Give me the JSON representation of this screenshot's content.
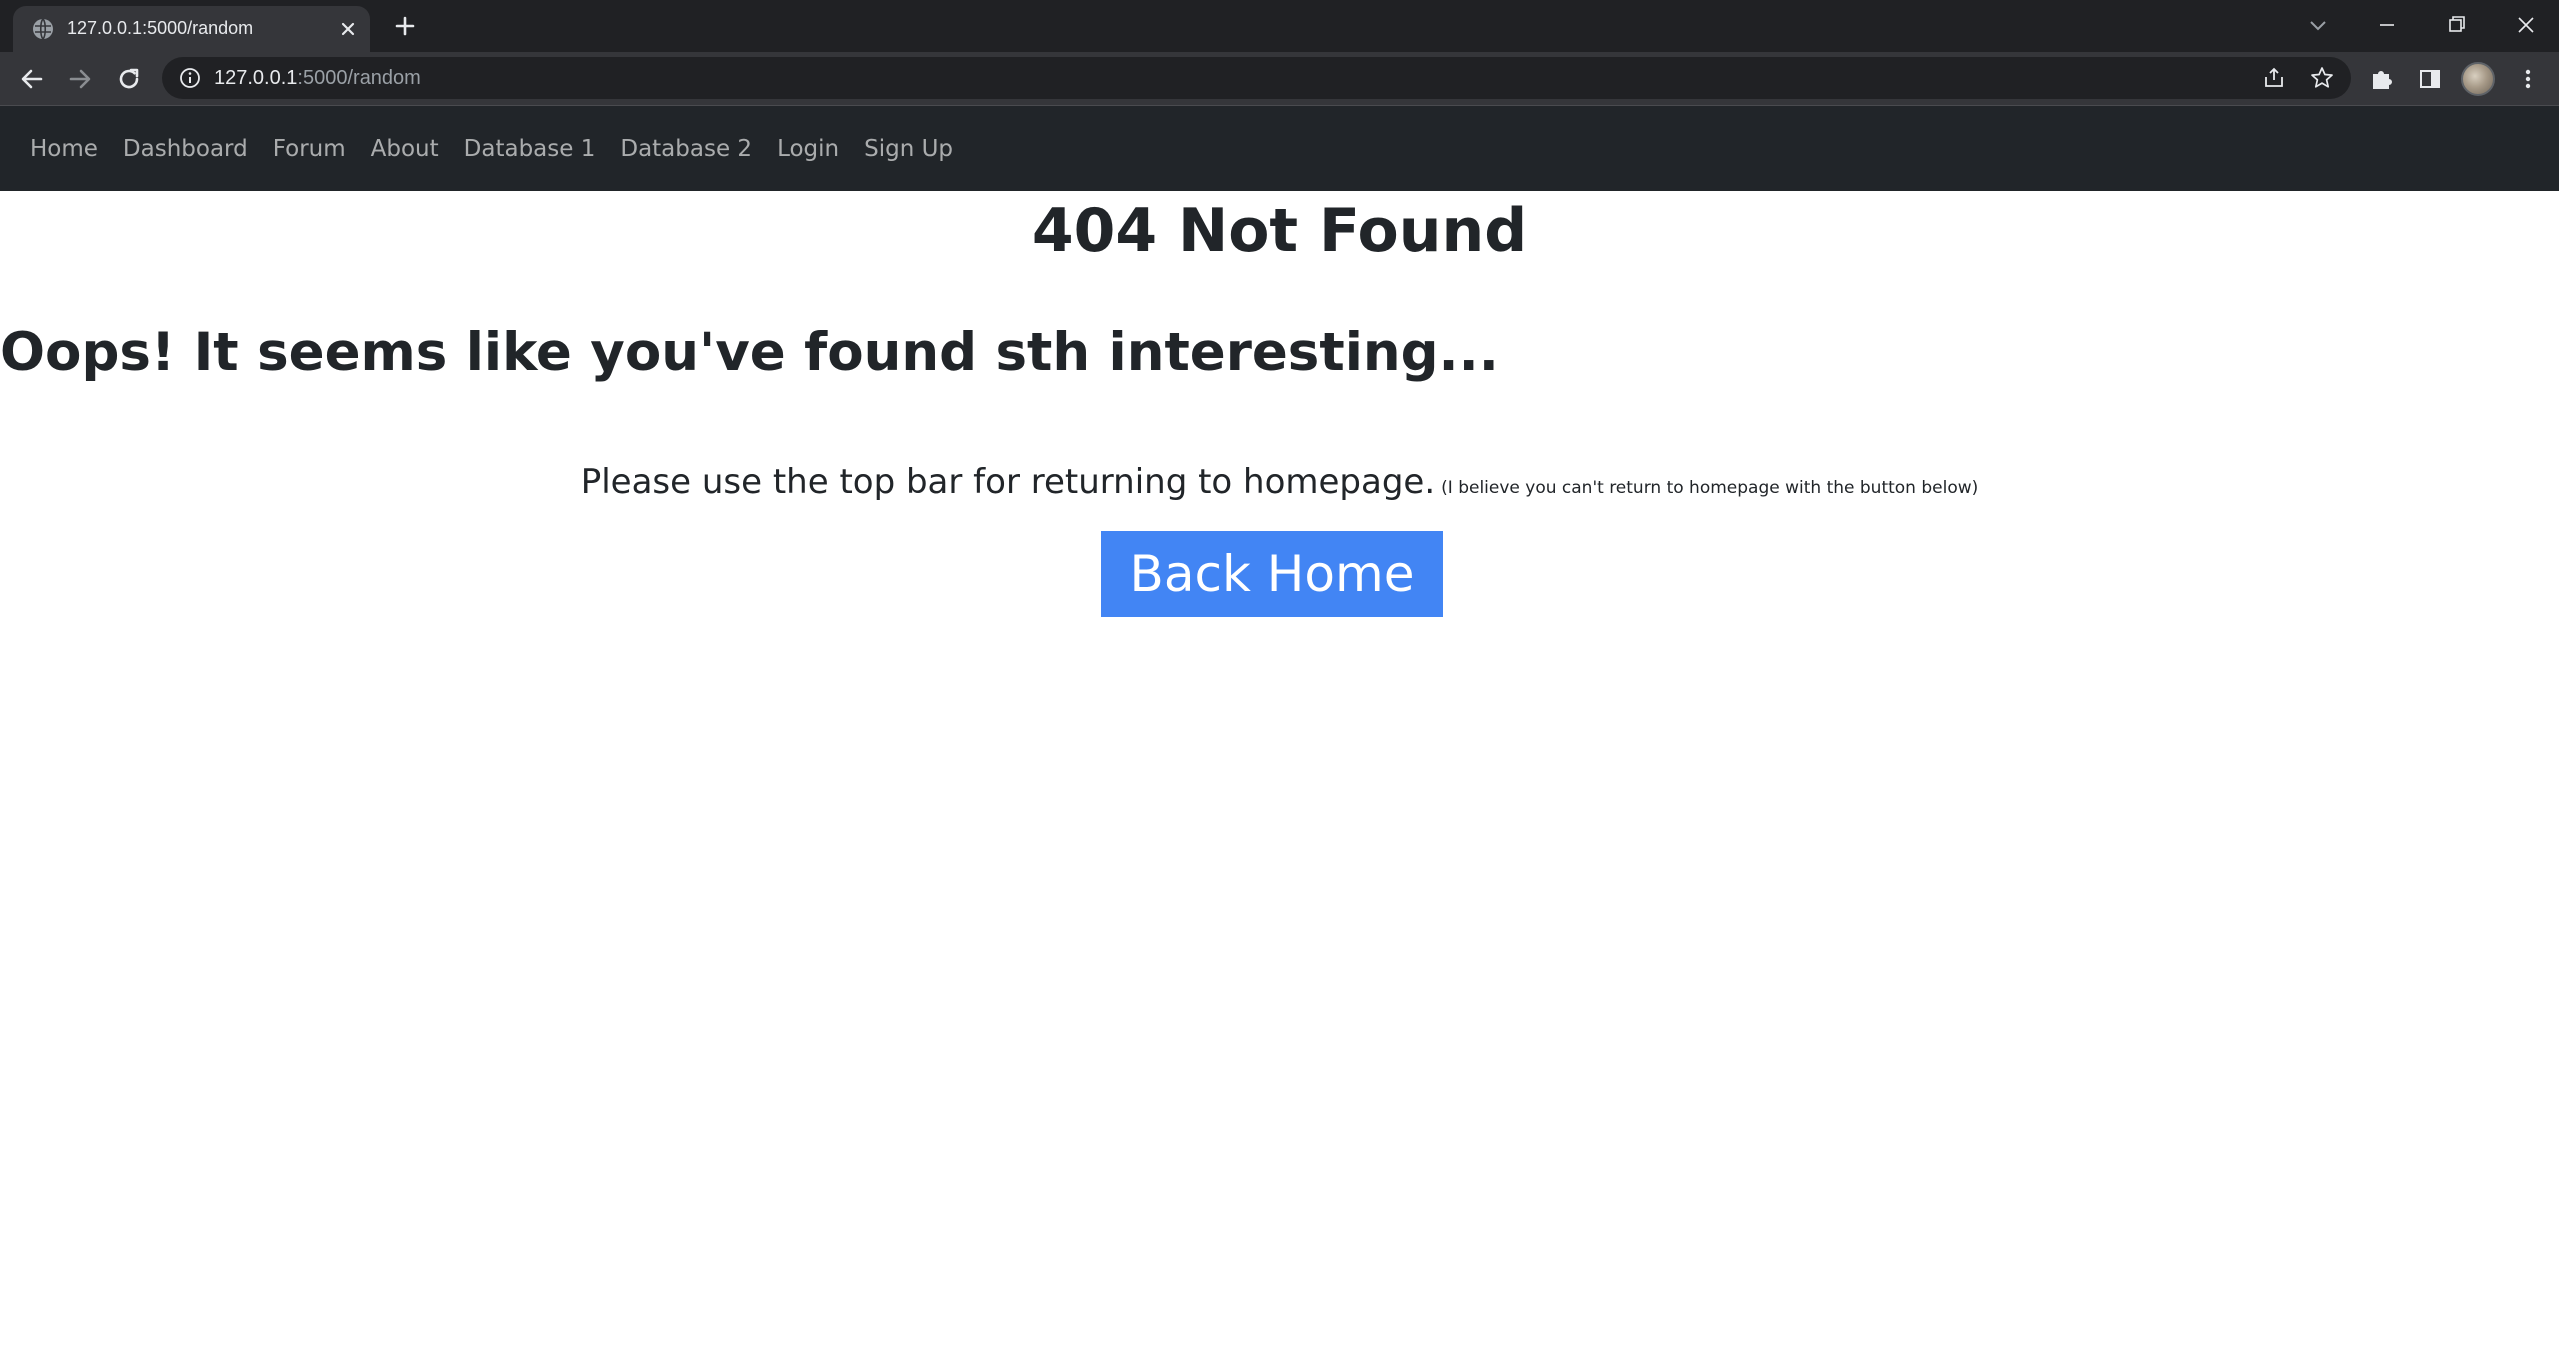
{
  "browser": {
    "tab_title": "127.0.0.1:5000/random",
    "url_host": "127.0.0.1",
    "url_rest": ":5000/random",
    "icons": [
      "globe-icon",
      "close-icon",
      "plus-icon",
      "chevron-down-icon",
      "minimize-icon",
      "restore-icon",
      "window-close-icon",
      "back-arrow-icon",
      "forward-arrow-icon",
      "reload-icon",
      "info-icon",
      "share-icon",
      "star-icon",
      "puzzle-icon",
      "side-panel-icon",
      "avatar",
      "kebab-menu-icon"
    ]
  },
  "navbar": {
    "items": [
      {
        "label": "Home"
      },
      {
        "label": "Dashboard"
      },
      {
        "label": "Forum"
      },
      {
        "label": "About"
      },
      {
        "label": "Database 1"
      },
      {
        "label": "Database 2"
      },
      {
        "label": "Login"
      },
      {
        "label": "Sign Up"
      }
    ]
  },
  "content": {
    "title": "404 Not Found",
    "subtitle": "Oops! It seems like you've found sth interesting...",
    "note": "Please use the top bar for returning to homepage.",
    "note_small": "(I believe you can't return to homepage with the button below)",
    "button_label": "Back Home"
  },
  "colors": {
    "navbar_bg": "#212529",
    "button_bg": "#4285f4",
    "text": "#212529"
  }
}
